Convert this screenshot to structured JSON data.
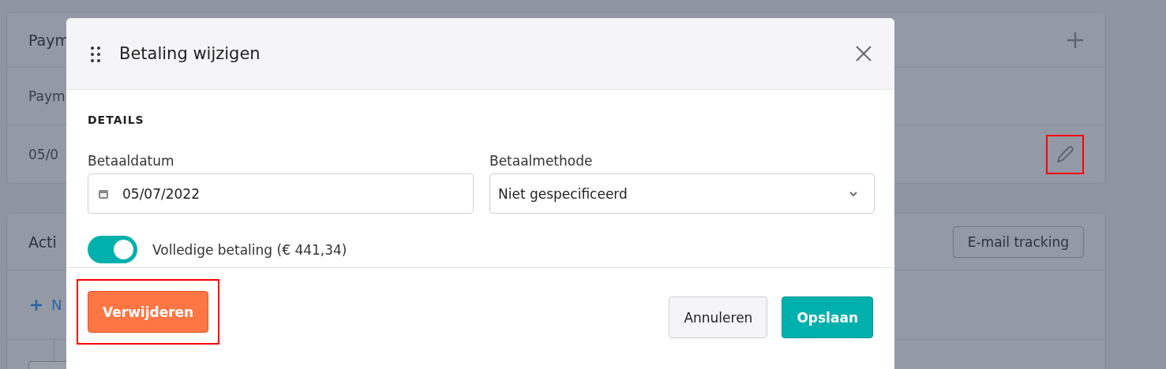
{
  "background": {
    "payments_card": {
      "title": "Paym",
      "column_header": "Paym",
      "rows": [
        {
          "cell_1": "05/0",
          "edit_highlighted": true
        }
      ]
    },
    "activity_card": {
      "title": "Acti",
      "email_tracking_button": "E-mail tracking",
      "new_link": "N"
    }
  },
  "dialog": {
    "title": "Betaling wijzigen",
    "section": "DETAILS",
    "fields": [
      {
        "kind": "date",
        "label": "Betaaldatum",
        "value": "05/07/2022"
      },
      {
        "kind": "select",
        "label": "Betaalmethode",
        "value": "Niet gespecificeerd"
      }
    ],
    "toggle": {
      "label": "Volledige betaling (€ 441,34)",
      "on": true
    },
    "buttons": [
      {
        "kind": "danger",
        "label": "Verwijderen",
        "highlighted": true
      },
      {
        "kind": "secondary",
        "label": "Annuleren",
        "highlighted": false
      },
      {
        "kind": "primary",
        "label": "Opslaan",
        "highlighted": false
      }
    ]
  }
}
